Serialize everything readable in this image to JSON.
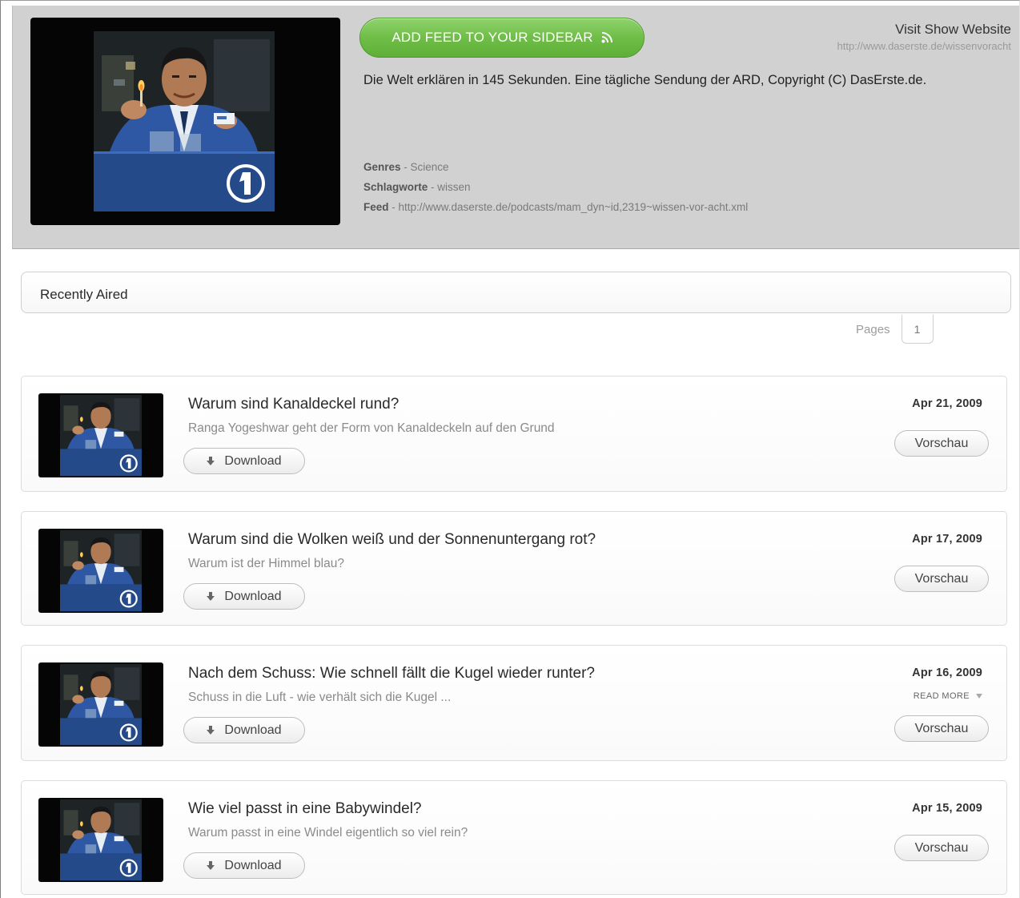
{
  "show": {
    "add_feed_label": "ADD FEED TO YOUR SIDEBAR",
    "visit_label": "Visit Show Website",
    "visit_url": "http://www.daserste.de/wissenvoracht",
    "description": "Die Welt erklären in 145 Sekunden. Eine tägliche Sendung der ARD, Copyright (C) DasErste.de.",
    "meta": {
      "genres_label": "Genres",
      "genres_value": "Science",
      "tags_label": "Schlagworte",
      "tags_value": "wissen",
      "feed_label": "Feed",
      "feed_value": "http://www.daserste.de/podcasts/mam_dyn~id,2319~wissen-vor-acht.xml"
    },
    "icons": [
      "rss-icon",
      "das-erste-logo"
    ],
    "accent_color": "#6fbe47"
  },
  "section": {
    "title": "Recently Aired",
    "pages_label": "Pages",
    "current_page": "1"
  },
  "episodes": [
    {
      "title": "Warum sind Kanaldeckel rund?",
      "subtitle": "Ranga Yogeshwar geht der Form von Kanaldeckeln auf den Grund",
      "date": "Apr 21, 2009",
      "download_label": "Download",
      "preview_label": "Vorschau",
      "read_more": ""
    },
    {
      "title": "Warum sind die Wolken weiß und der Sonnenuntergang rot?",
      "subtitle": "Warum ist der Himmel blau?",
      "date": "Apr 17, 2009",
      "download_label": "Download",
      "preview_label": "Vorschau",
      "read_more": ""
    },
    {
      "title": "Nach dem Schuss: Wie schnell fällt die Kugel wieder runter?",
      "subtitle": "Schuss in die Luft - wie verhält sich die Kugel ...",
      "date": "Apr 16, 2009",
      "download_label": "Download",
      "preview_label": "Vorschau",
      "read_more": "READ MORE"
    },
    {
      "title": "Wie viel passt in eine Babywindel?",
      "subtitle": "Warum passt in eine Windel eigentlich so viel rein?",
      "date": "Apr 15, 2009",
      "download_label": "Download",
      "preview_label": "Vorschau",
      "read_more": ""
    }
  ]
}
